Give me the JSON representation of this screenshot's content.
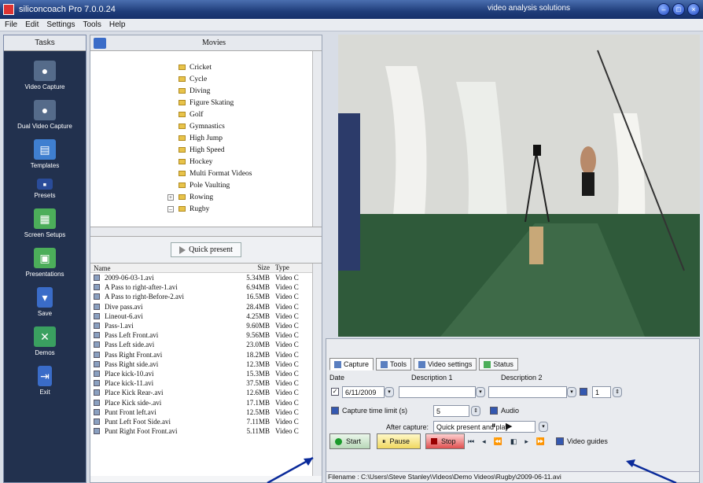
{
  "window": {
    "title": "siliconcoach Pro 7.0.0.24",
    "tagline": "video analysis solutions"
  },
  "menu": [
    "File",
    "Edit",
    "Settings",
    "Tools",
    "Help"
  ],
  "tasks": {
    "header": "Tasks",
    "items": [
      {
        "label": "Video Capture",
        "icon": "video-camera-icon"
      },
      {
        "label": "Dual Video Capture",
        "icon": "dual-camera-icon"
      },
      {
        "label": "Templates",
        "icon": "templates-icon"
      },
      {
        "label": "Presets",
        "icon": "presets-icon"
      },
      {
        "label": "Screen Setups",
        "icon": "screen-setups-icon"
      },
      {
        "label": "Presentations",
        "icon": "presentations-icon"
      },
      {
        "label": "Save",
        "icon": "save-icon"
      },
      {
        "label": "Demos",
        "icon": "demos-icon"
      },
      {
        "label": "Exit",
        "icon": "exit-icon"
      }
    ]
  },
  "movies": {
    "header": "Movies",
    "folders": [
      "Cricket",
      "Cycle",
      "Diving",
      "Figure Skating",
      "Golf",
      "Gymnastics",
      "High Jump",
      "High Speed",
      "Hockey",
      "Multi Format Videos",
      "Pole Vaulting",
      "Rowing",
      "Rugby"
    ],
    "quick_present": "Quick present",
    "columns": {
      "name": "Name",
      "size": "Size",
      "type": "Type"
    },
    "files": [
      {
        "name": "2009-06-03-1.avi",
        "size": "5.34MB",
        "type": "Video C"
      },
      {
        "name": "A Pass to right-after-1.avi",
        "size": "6.94MB",
        "type": "Video C"
      },
      {
        "name": "A Pass to right-Before-2.avi",
        "size": "16.5MB",
        "type": "Video C"
      },
      {
        "name": "Dive pass.avi",
        "size": "28.4MB",
        "type": "Video C"
      },
      {
        "name": "Lineout-6.avi",
        "size": "4.25MB",
        "type": "Video C"
      },
      {
        "name": "Pass-1.avi",
        "size": "9.60MB",
        "type": "Video C"
      },
      {
        "name": "Pass Left Front.avi",
        "size": "9.56MB",
        "type": "Video C"
      },
      {
        "name": "Pass Left side.avi",
        "size": "23.0MB",
        "type": "Video C"
      },
      {
        "name": "Pass Right Front.avi",
        "size": "18.2MB",
        "type": "Video C"
      },
      {
        "name": "Pass Right side.avi",
        "size": "12.3MB",
        "type": "Video C"
      },
      {
        "name": "Place kick-10.avi",
        "size": "15.3MB",
        "type": "Video C"
      },
      {
        "name": "Place kick-11.avi",
        "size": "37.5MB",
        "type": "Video C"
      },
      {
        "name": "Place Kick Rear-.avi",
        "size": "12.6MB",
        "type": "Video C"
      },
      {
        "name": "Place Kick side-.avi",
        "size": "17.1MB",
        "type": "Video C"
      },
      {
        "name": "Punt Front left.avi",
        "size": "12.5MB",
        "type": "Video C"
      },
      {
        "name": "Punt Left Foot Side.avi",
        "size": "7.11MB",
        "type": "Video C"
      },
      {
        "name": "Punt Right Foot Front.avi",
        "size": "5.11MB",
        "type": "Video C"
      }
    ]
  },
  "capture": {
    "tabs": [
      "Capture",
      "Tools",
      "Video settings",
      "Status"
    ],
    "date_label": "Date",
    "date_value": "6/11/2009",
    "desc1_label": "Description 1",
    "desc2_label": "Description 2",
    "counter_value": "1",
    "time_limit_label": "Capture time limit (s)",
    "time_limit_value": "5",
    "audio_label": "Audio",
    "after_capture_label": "After capture:",
    "after_capture_value": "Quick present and play",
    "start": "Start",
    "pause": "Pause",
    "stop": "Stop",
    "video_guides": "Video guides",
    "filename": "Filename : C:\\Users\\Steve Stanley\\Videos\\Demo Videos\\Rugby\\2009-06-11.avi"
  }
}
